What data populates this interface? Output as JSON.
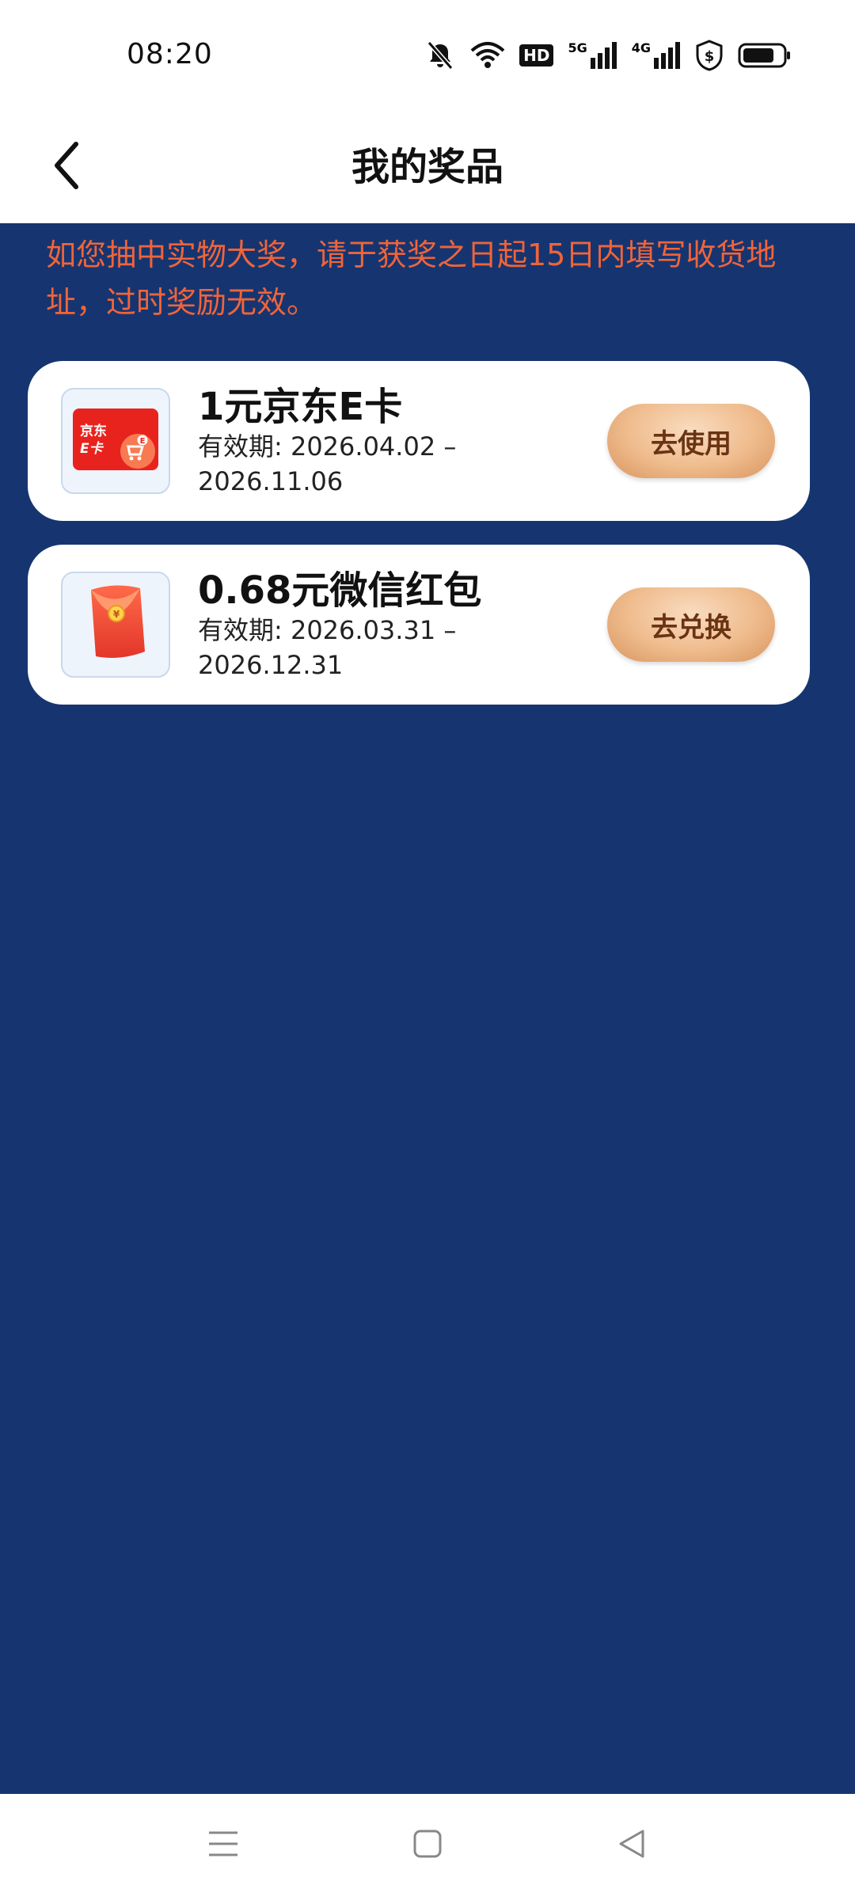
{
  "status_bar": {
    "time": "08:20",
    "icons": [
      "mute-icon",
      "wifi-icon",
      "hd-icon",
      "5g-signal-icon",
      "4g-signal-icon",
      "shield-dollar-icon",
      "battery-icon"
    ],
    "hd_label": "HD",
    "net1_label": "5G",
    "net2_label": "4G",
    "battery_level": 0.8
  },
  "header": {
    "title": "我的奖品",
    "back_icon": "chevron-left-icon"
  },
  "notice": "如您抽中实物大奖，请于获奖之日起15日内填写收货地址，过时奖励无效。",
  "prizes": [
    {
      "title": "1元京东E卡",
      "validity": "有效期: 2026.04.02 – 2026.11.06",
      "action": "去使用",
      "thumb_icon": "jd-ecard-icon",
      "thumb_text_1": "京东",
      "thumb_text_2": "E卡"
    },
    {
      "title": "0.68元微信红包",
      "validity": "有效期: 2026.03.31 – 2026.12.31",
      "action": "去兑换",
      "thumb_icon": "red-envelope-icon"
    }
  ],
  "nav_bar": {
    "icons": [
      "menu-icon",
      "home-square-icon",
      "back-triangle-icon"
    ]
  },
  "colors": {
    "background": "#163570",
    "notice_text": "#f0643a",
    "button_gradient_start": "#f9dcc0",
    "button_gradient_end": "#d8955f",
    "button_text": "#6a3414"
  }
}
